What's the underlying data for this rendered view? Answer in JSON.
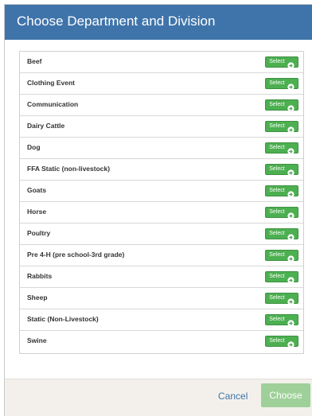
{
  "dialog": {
    "title": "Choose Department and Division"
  },
  "departments": [
    {
      "label": "Beef",
      "button": "Select"
    },
    {
      "label": "Clothing Event",
      "button": "Select"
    },
    {
      "label": "Communication",
      "button": "Select"
    },
    {
      "label": "Dairy Cattle",
      "button": "Select"
    },
    {
      "label": "Dog",
      "button": "Select"
    },
    {
      "label": "FFA Static (non-livestock)",
      "button": "Select"
    },
    {
      "label": "Goats",
      "button": "Select"
    },
    {
      "label": "Horse",
      "button": "Select"
    },
    {
      "label": "Poultry",
      "button": "Select"
    },
    {
      "label": "Pre 4-H (pre school-3rd grade)",
      "button": "Select"
    },
    {
      "label": "Rabbits",
      "button": "Select"
    },
    {
      "label": "Sheep",
      "button": "Select"
    },
    {
      "label": "Static (Non-Livestock)",
      "button": "Select"
    },
    {
      "label": "Swine",
      "button": "Select"
    }
  ],
  "icons": {
    "select_button_icon": "circle-arrow-right-icon"
  },
  "footer": {
    "cancel_label": "Cancel",
    "choose_label": "Choose"
  },
  "colors": {
    "header": "#3f74aa",
    "select_button": "#4caf50",
    "choose_button_disabled": "#9fd09a",
    "cancel_link": "#3f74aa"
  }
}
